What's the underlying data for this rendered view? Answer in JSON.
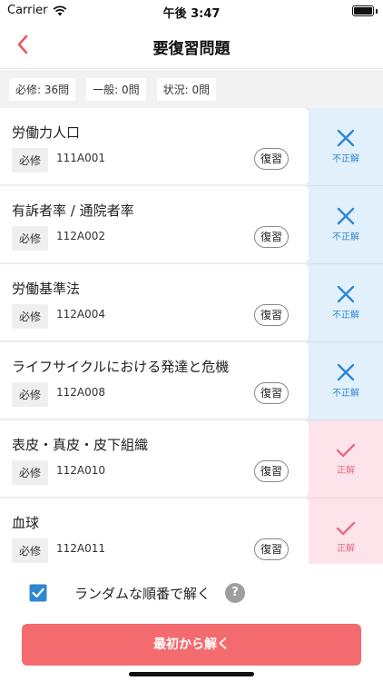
{
  "status_bar": {
    "carrier": "Carrier",
    "time": "午後 3:47"
  },
  "nav": {
    "title": "要復習問題",
    "back_icon": "chevron-left-icon",
    "accent": "#e85a5f"
  },
  "counts": [
    {
      "label": "必修: 36問"
    },
    {
      "label": "一般: 0問"
    },
    {
      "label": "状況: 0問"
    }
  ],
  "questions": [
    {
      "title": "労働力人口",
      "tag": "必修",
      "code": "111A001",
      "review": "復習",
      "result": "不正解",
      "status": "wrong"
    },
    {
      "title": "有訴者率 / 通院者率",
      "tag": "必修",
      "code": "112A002",
      "review": "復習",
      "result": "不正解",
      "status": "wrong"
    },
    {
      "title": "労働基準法",
      "tag": "必修",
      "code": "112A004",
      "review": "復習",
      "result": "不正解",
      "status": "wrong"
    },
    {
      "title": "ライフサイクルにおける発達と危機",
      "tag": "必修",
      "code": "112A008",
      "review": "復習",
      "result": "不正解",
      "status": "wrong"
    },
    {
      "title": "表皮・真皮・皮下組織",
      "tag": "必修",
      "code": "112A010",
      "review": "復習",
      "result": "正解",
      "status": "correct"
    },
    {
      "title": "血球",
      "tag": "必修",
      "code": "112A011",
      "review": "復習",
      "result": "正解",
      "status": "correct"
    }
  ],
  "footer": {
    "random_label": "ランダムな順番で解く",
    "random_checked": true,
    "help": "?",
    "start_label": "最初から解く"
  },
  "colors": {
    "wrong": "#2f87d0",
    "correct": "#e86a7e",
    "checkbox": "#2f87d0",
    "start": "#f36b6f"
  }
}
